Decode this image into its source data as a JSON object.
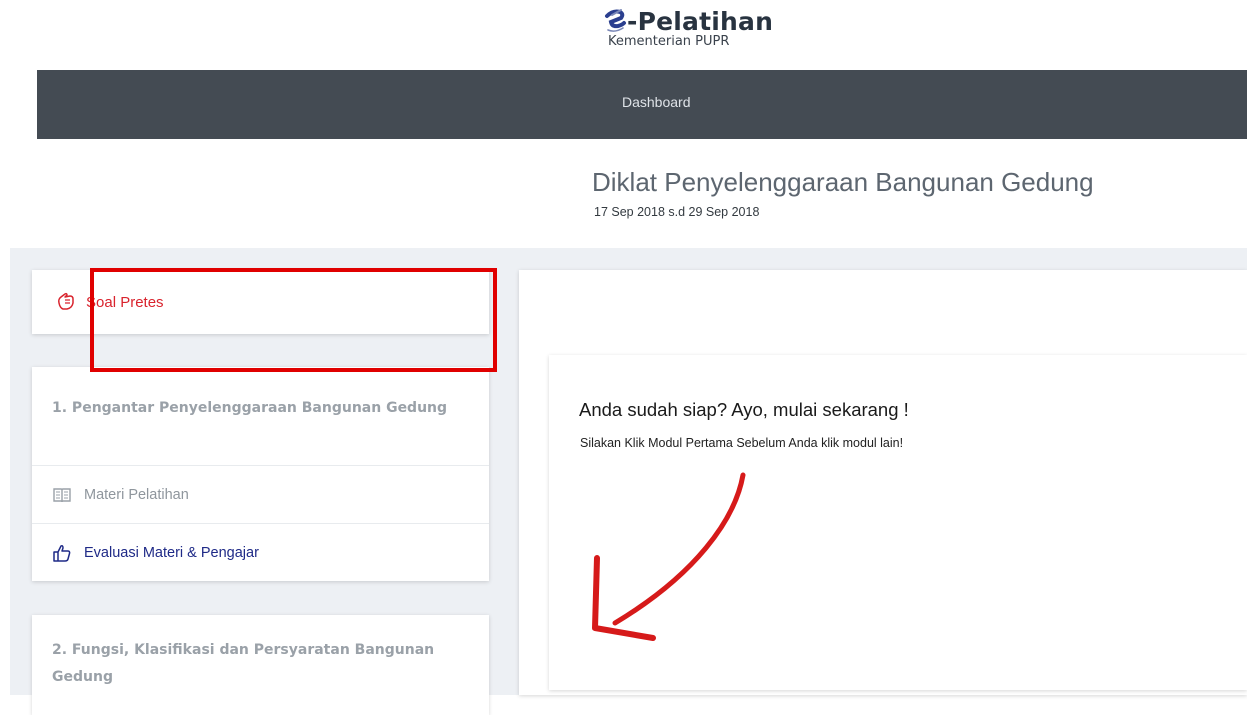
{
  "header": {
    "brand_prefix": "e",
    "brand_name": "-Pelatihan",
    "brand_subtitle": "Kementerian PUPR"
  },
  "nav": {
    "items": [
      {
        "label": "Dashboard"
      }
    ]
  },
  "course": {
    "title": "Diklat Penyelenggaraan Bangunan Gedung",
    "dates": "17 Sep 2018 s.d 29 Sep 2018"
  },
  "sidebar": {
    "pretest": {
      "label": "Soal Pretes",
      "icon": "pretest-hand-icon"
    },
    "modules": [
      {
        "title": "1. Pengantar Penyelenggaraan Bangunan Gedung",
        "items": [
          {
            "label": "Materi Pelatihan",
            "icon": "book-icon"
          },
          {
            "label": "Evaluasi Materi & Pengajar",
            "icon": "thumbs-up-icon"
          }
        ]
      },
      {
        "title": "2. Fungsi, Klasifikasi dan Persyaratan Bangunan Gedung"
      }
    ]
  },
  "main": {
    "heading": "Anda sudah siap? Ayo, mulai sekarang !",
    "subtext": "Silakan Klik Modul Pertama Sebelum Anda klik modul lain!"
  },
  "colors": {
    "navbar": "#444b53",
    "pretest_red": "#d9232d",
    "highlight_red": "#e00000",
    "link_blue": "#1f2a87",
    "band_bg": "#edf0f4"
  }
}
